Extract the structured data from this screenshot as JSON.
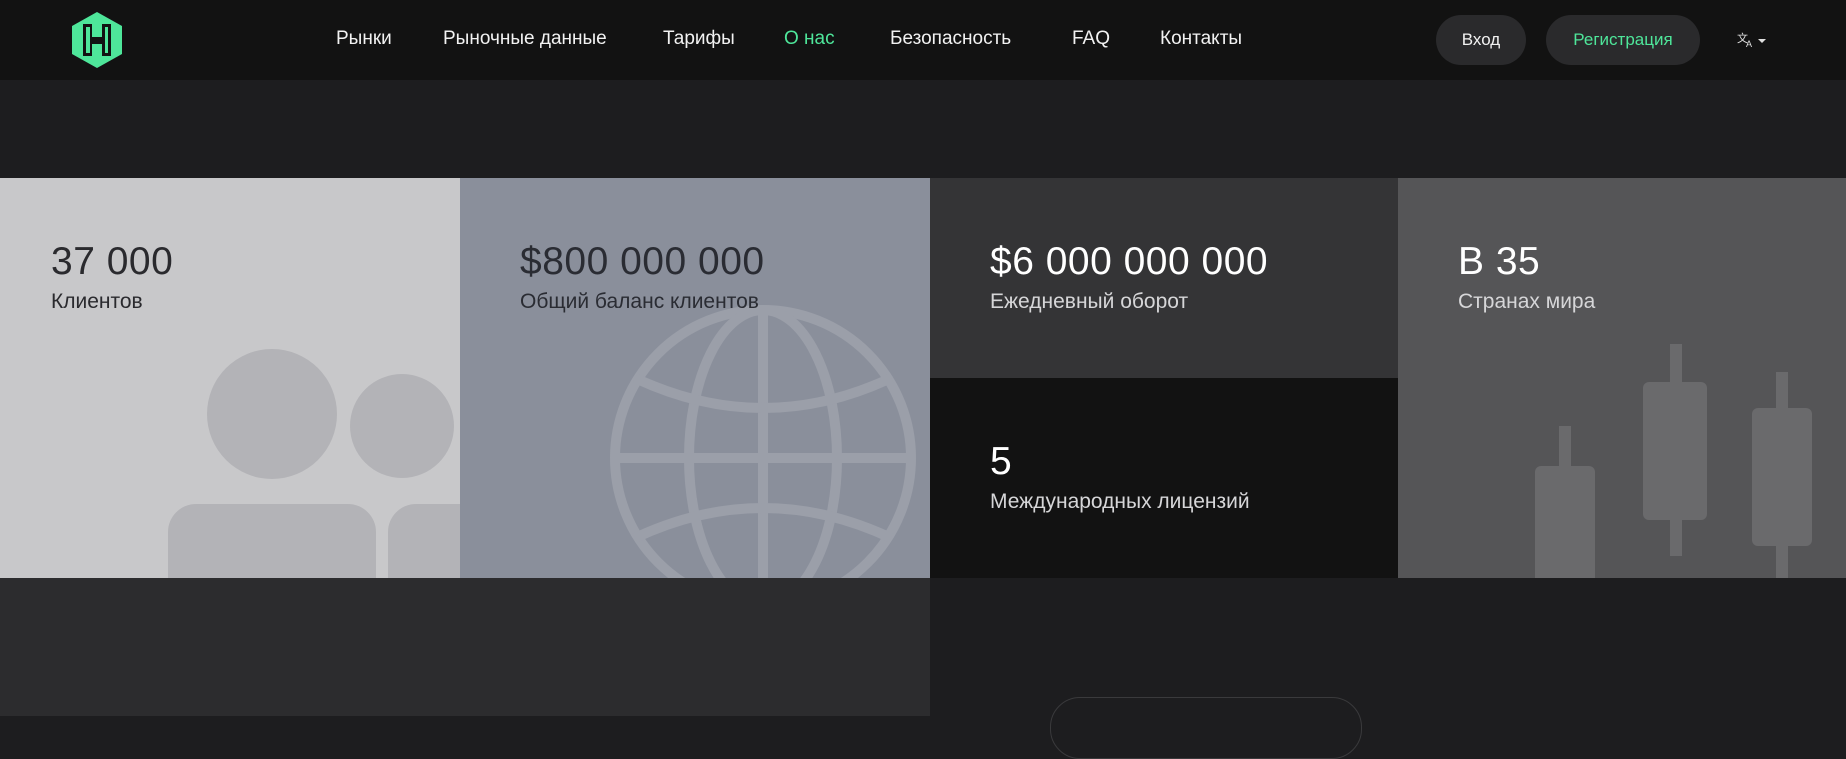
{
  "nav": {
    "items": [
      {
        "label": "Рынки"
      },
      {
        "label": "Рыночные данные"
      },
      {
        "label": "Тарифы"
      },
      {
        "label": "О нас",
        "active": true
      },
      {
        "label": "Безопасность"
      },
      {
        "label": "FAQ"
      },
      {
        "label": "Контакты"
      }
    ],
    "login_label": "Вход",
    "register_label": "Регистрация"
  },
  "colors": {
    "accent": "#4ee69a",
    "header_bg": "#121212",
    "page_bg": "#1d1d1f"
  },
  "stats": [
    {
      "value": "37 000",
      "label": "Клиентов",
      "icon": "people-icon"
    },
    {
      "value": "$800 000 000",
      "label": "Общий баланс клиентов",
      "icon": "globe-icon"
    },
    {
      "value": "$6 000 000 000",
      "label": "Ежедневный оборот"
    },
    {
      "value": "5",
      "label": "Международных лицензий"
    },
    {
      "value": "В 35",
      "label": "Странах мира",
      "icon": "candlestick-icon"
    }
  ]
}
